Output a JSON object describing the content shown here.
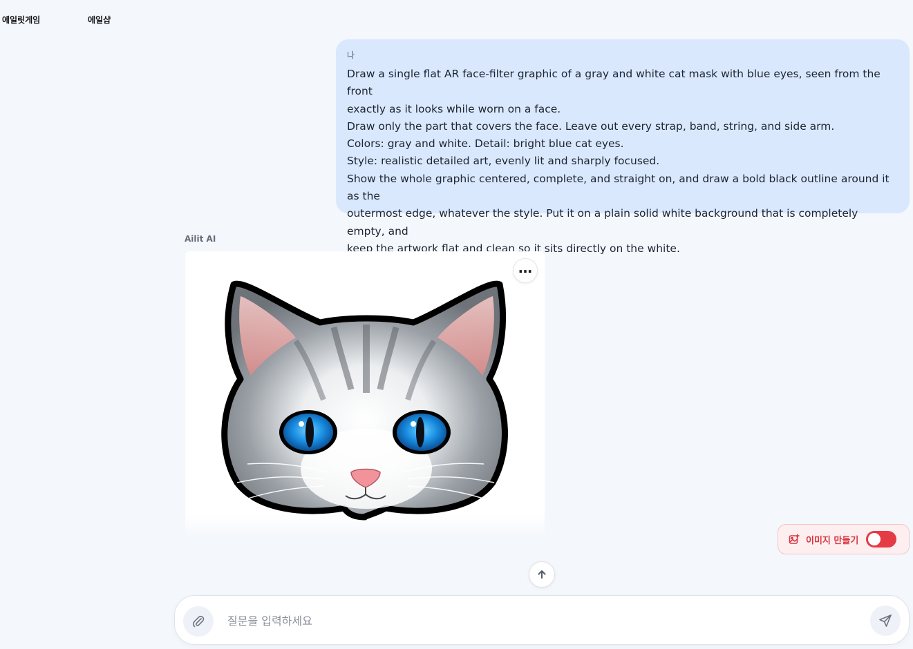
{
  "nav": {
    "game_label": "에일릿게임",
    "shop_label": "에일샵"
  },
  "user_message": {
    "sender": "나",
    "lines": [
      "Draw a single flat AR face-filter graphic of a gray and white cat mask with blue eyes, seen from the front",
      "exactly as it looks while worn on a face.",
      "Draw only the part that covers the face. Leave out every strap, band, string, and side arm.",
      "Colors: gray and white. Detail: bright blue cat eyes.",
      "Style: realistic detailed art, evenly lit and sharply focused.",
      "Show the whole graphic centered, complete, and straight on, and draw a bold black outline around it as the",
      "outermost edge, whatever the style. Put it on a plain solid white background that is completely empty, and",
      "keep the artwork flat and clean so it sits directly on the white."
    ]
  },
  "ai_message": {
    "sender": "Ailit AI"
  },
  "image_toggle": {
    "label": "이미지 만들기",
    "enabled": true
  },
  "composer": {
    "placeholder": "질문을 입력하세요",
    "value": ""
  },
  "colors": {
    "accent_red": "#e43b44",
    "user_bubble": "#dae8fd",
    "page_background": "#f4f7fc"
  }
}
